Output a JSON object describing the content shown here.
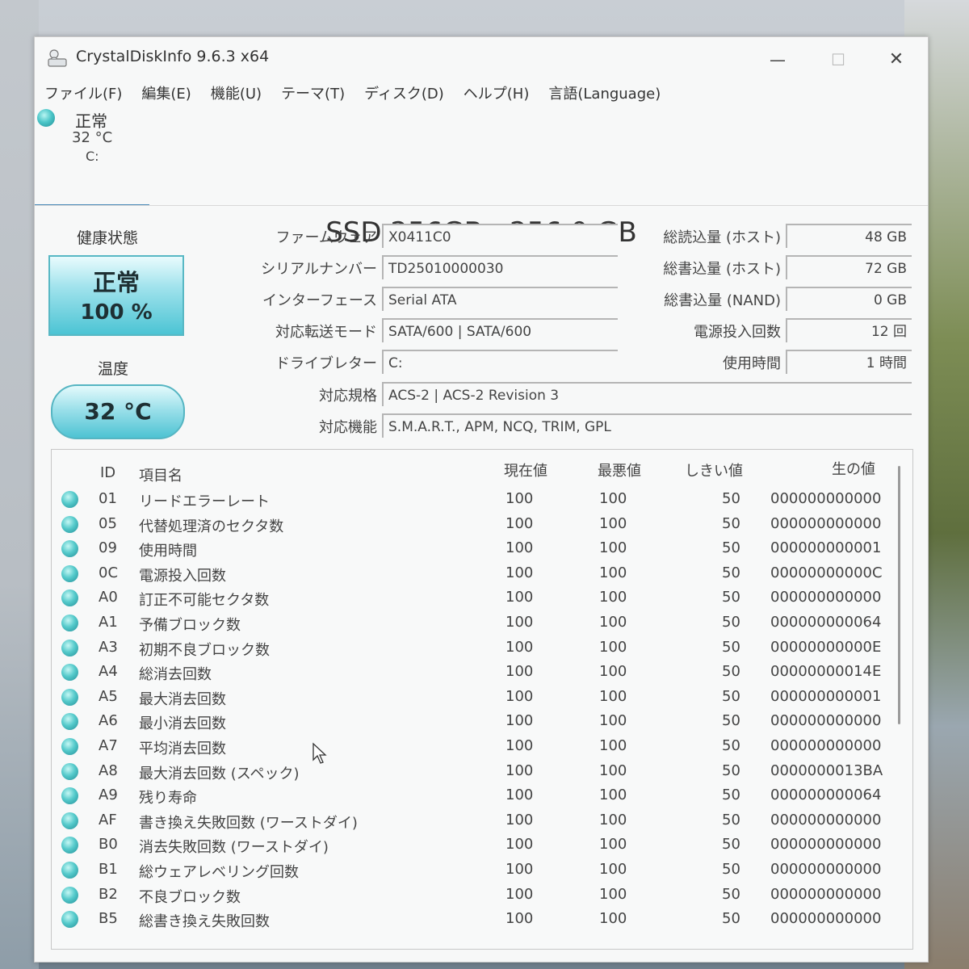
{
  "window": {
    "title": "CrystalDiskInfo 9.6.3 x64",
    "controls": {
      "minimize": "—",
      "maximize": "☐",
      "close": "✕"
    }
  },
  "menu": [
    "ファイル(F)",
    "編集(E)",
    "機能(U)",
    "テーマ(T)",
    "ディスク(D)",
    "ヘルプ(H)",
    "言語(Language)"
  ],
  "disk_tab": {
    "status": "正常",
    "temperature": "32 °C",
    "letter": "C:"
  },
  "model": "SSD 256GB : 256.0 GB",
  "health": {
    "label": "健康状態",
    "status": "正常",
    "percent": "100 %"
  },
  "temperature": {
    "label": "温度",
    "value": "32 °C"
  },
  "info": {
    "firmware_label": "ファームウェア",
    "firmware": "X0411C0",
    "serial_label": "シリアルナンバー",
    "serial": "TD25010000030",
    "interface_label": "インターフェース",
    "interface": "Serial ATA",
    "transfer_label": "対応転送モード",
    "transfer": "SATA/600 | SATA/600",
    "drive_letter_label": "ドライブレター",
    "drive_letter": "C:",
    "standard_label": "対応規格",
    "standard": "ACS-2 | ACS-2 Revision 3",
    "features_label": "対応機能",
    "features": "S.M.A.R.T., APM, NCQ, TRIM, GPL",
    "host_reads_label": "総読込量 (ホスト)",
    "host_reads": "48 GB",
    "host_writes_label": "総書込量 (ホスト)",
    "host_writes": "72 GB",
    "nand_writes_label": "総書込量 (NAND)",
    "nand_writes": "0 GB",
    "power_on_count_label": "電源投入回数",
    "power_on_count": "12 回",
    "power_on_hours_label": "使用時間",
    "power_on_hours": "1 時間"
  },
  "smart": {
    "headers": {
      "id": "ID",
      "name": "項目名",
      "current": "現在値",
      "worst": "最悪値",
      "threshold": "しきい値",
      "raw": "生の値"
    },
    "rows": [
      {
        "id": "01",
        "name": "リードエラーレート",
        "current": "100",
        "worst": "100",
        "threshold": "50",
        "raw": "000000000000"
      },
      {
        "id": "05",
        "name": "代替処理済のセクタ数",
        "current": "100",
        "worst": "100",
        "threshold": "50",
        "raw": "000000000000"
      },
      {
        "id": "09",
        "name": "使用時間",
        "current": "100",
        "worst": "100",
        "threshold": "50",
        "raw": "000000000001"
      },
      {
        "id": "0C",
        "name": "電源投入回数",
        "current": "100",
        "worst": "100",
        "threshold": "50",
        "raw": "00000000000C"
      },
      {
        "id": "A0",
        "name": "訂正不可能セクタ数",
        "current": "100",
        "worst": "100",
        "threshold": "50",
        "raw": "000000000000"
      },
      {
        "id": "A1",
        "name": "予備ブロック数",
        "current": "100",
        "worst": "100",
        "threshold": "50",
        "raw": "000000000064"
      },
      {
        "id": "A3",
        "name": "初期不良ブロック数",
        "current": "100",
        "worst": "100",
        "threshold": "50",
        "raw": "00000000000E"
      },
      {
        "id": "A4",
        "name": "総消去回数",
        "current": "100",
        "worst": "100",
        "threshold": "50",
        "raw": "00000000014E"
      },
      {
        "id": "A5",
        "name": "最大消去回数",
        "current": "100",
        "worst": "100",
        "threshold": "50",
        "raw": "000000000001"
      },
      {
        "id": "A6",
        "name": "最小消去回数",
        "current": "100",
        "worst": "100",
        "threshold": "50",
        "raw": "000000000000"
      },
      {
        "id": "A7",
        "name": "平均消去回数",
        "current": "100",
        "worst": "100",
        "threshold": "50",
        "raw": "000000000000"
      },
      {
        "id": "A8",
        "name": "最大消去回数 (スペック)",
        "current": "100",
        "worst": "100",
        "threshold": "50",
        "raw": "0000000013BA"
      },
      {
        "id": "A9",
        "name": "残り寿命",
        "current": "100",
        "worst": "100",
        "threshold": "50",
        "raw": "000000000064"
      },
      {
        "id": "AF",
        "name": "書き換え失敗回数 (ワーストダイ)",
        "current": "100",
        "worst": "100",
        "threshold": "50",
        "raw": "000000000000"
      },
      {
        "id": "B0",
        "name": "消去失敗回数 (ワーストダイ)",
        "current": "100",
        "worst": "100",
        "threshold": "50",
        "raw": "000000000000"
      },
      {
        "id": "B1",
        "name": "総ウェアレベリング回数",
        "current": "100",
        "worst": "100",
        "threshold": "50",
        "raw": "000000000000"
      },
      {
        "id": "B2",
        "name": "不良ブロック数",
        "current": "100",
        "worst": "100",
        "threshold": "50",
        "raw": "000000000000"
      },
      {
        "id": "B5",
        "name": "総書き換え失敗回数",
        "current": "100",
        "worst": "100",
        "threshold": "50",
        "raw": "000000000000"
      }
    ]
  }
}
